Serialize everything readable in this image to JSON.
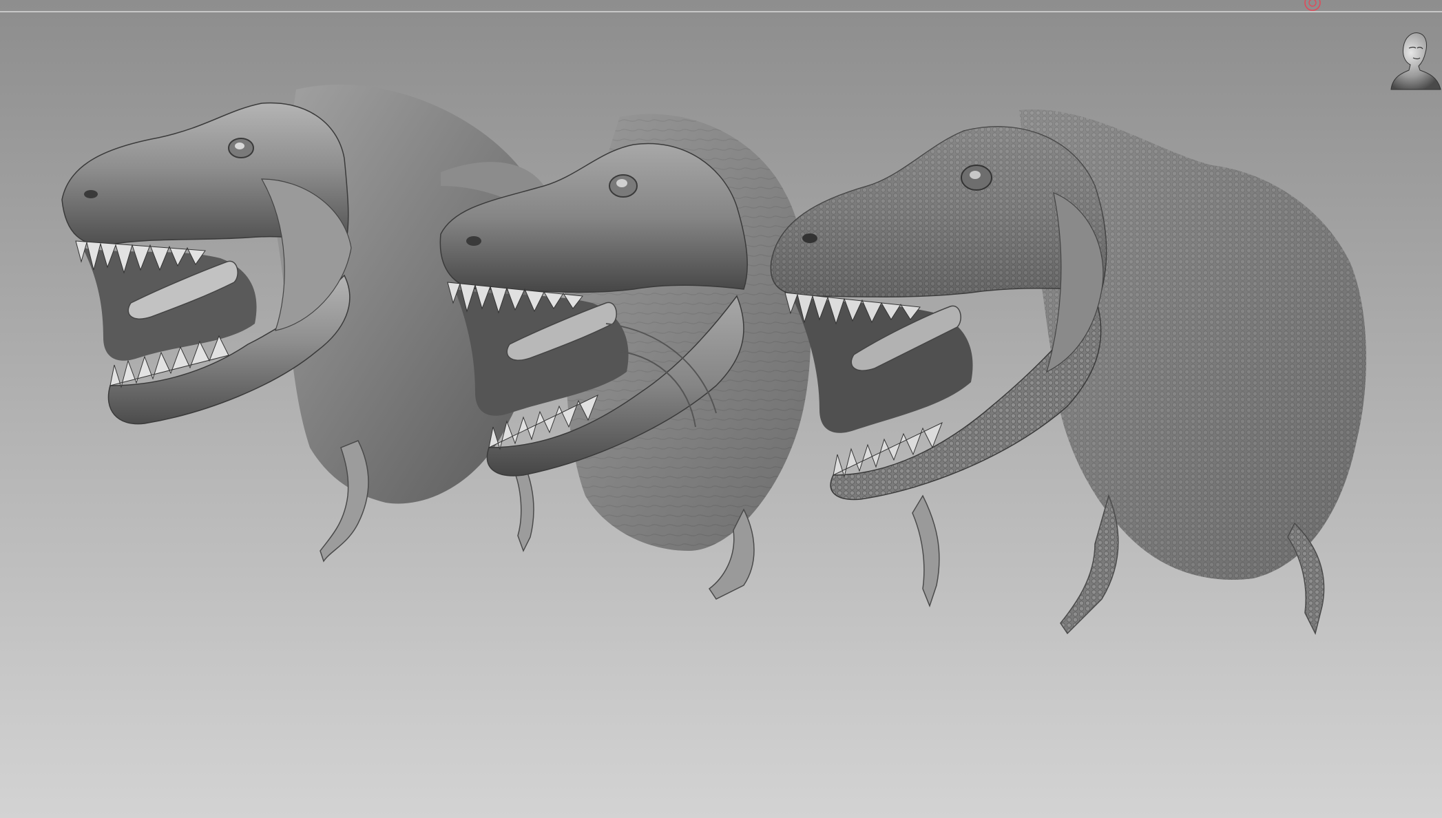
{
  "viewport": {
    "background_top": "#8d8d8d",
    "background_bottom": "#d3d3d3",
    "edge_line": "#c8c8c8"
  },
  "marker": {
    "icon": "pivot-marker-icon",
    "color": "#e04a5a"
  },
  "navigator": {
    "icon": "head-bust-icon"
  },
  "models": [
    {
      "name": "t-rex-low-detail",
      "surface": "smooth blocky"
    },
    {
      "name": "t-rex-mid-detail",
      "surface": "wrinkled"
    },
    {
      "name": "t-rex-high-detail",
      "surface": "scaled"
    }
  ],
  "material": {
    "base": "#8a8a8a",
    "shadow": "#3e3e3e",
    "highlight": "#dcdcdc"
  }
}
